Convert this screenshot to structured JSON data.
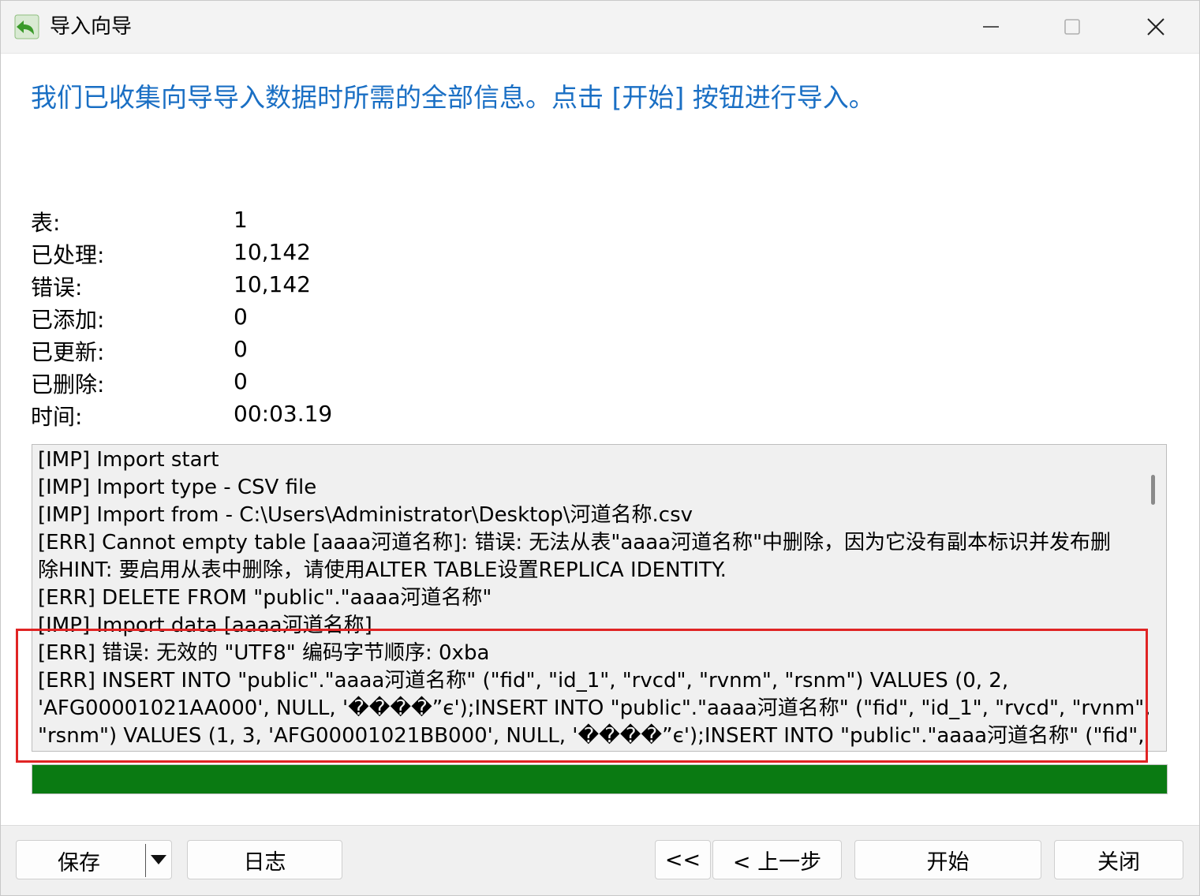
{
  "window": {
    "title": "导入向导",
    "min_label": "—",
    "close_label": "✕"
  },
  "header": {
    "message": "我们已收集向导导入数据时所需的全部信息。点击 [开始] 按钮进行导入。"
  },
  "stats": [
    {
      "label": "表:",
      "value": "1"
    },
    {
      "label": "已处理:",
      "value": "10,142"
    },
    {
      "label": "错误:",
      "value": "10,142"
    },
    {
      "label": "已添加:",
      "value": "0"
    },
    {
      "label": "已更新:",
      "value": "0"
    },
    {
      "label": "已删除:",
      "value": "0"
    },
    {
      "label": "时间:",
      "value": "00:03.19"
    }
  ],
  "log": [
    "[IMP] Import start",
    "[IMP] Import type - CSV file",
    "[IMP] Import from - C:\\Users\\Administrator\\Desktop\\河道名称.csv",
    "[ERR] Cannot empty table [aaaa河道名称]: 错误:  无法从表\"aaaa河道名称\"中删除，因为它没有副本标识并发布删",
    "除HINT:  要启用从表中删除，请使用ALTER TABLE设置REPLICA IDENTITY.",
    "[ERR] DELETE FROM \"public\".\"aaaa河道名称\"",
    "[IMP] Import data [aaaa河道名称]",
    "[ERR] 错误:  无效的 \"UTF8\" 编码字节顺序: 0xba",
    "[ERR] INSERT INTO \"public\".\"aaaa河道名称\" (\"fid\", \"id_1\", \"rvcd\", \"rvnm\", \"rsnm\") VALUES (0, 2,",
    "'AFG00001021AA000', NULL, '����”є');INSERT INTO \"public\".\"aaaa河道名称\" (\"fid\", \"id_1\", \"rvcd\", \"rvnm\",",
    "\"rsnm\") VALUES (1, 3, 'AFG00001021BB000', NULL, '����”є');INSERT INTO \"public\".\"aaaa河道名称\" (\"fid\","
  ],
  "progress": {
    "percent": 100,
    "color": "#0a7a12"
  },
  "colors": {
    "accent": "#1a6fc4",
    "highlight": "#e02424"
  },
  "footer": {
    "save_label": "保存",
    "log_label": "日志",
    "first_label": "<<",
    "prev_label": "< 上一步",
    "start_label": "开始",
    "close_label": "关闭"
  }
}
